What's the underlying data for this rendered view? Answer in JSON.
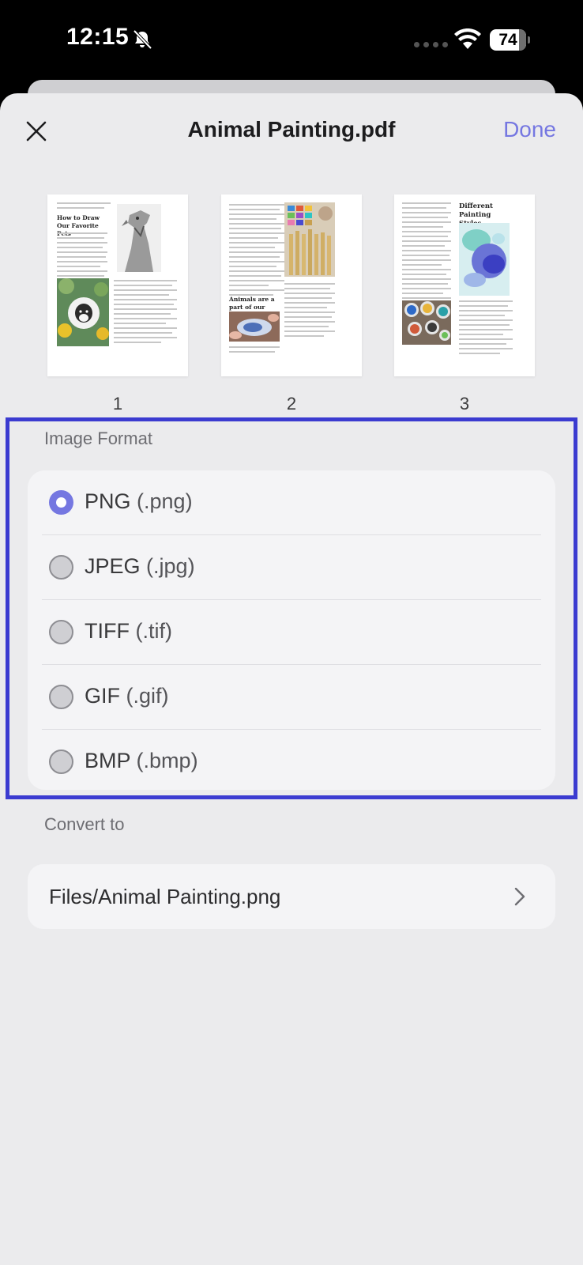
{
  "status_bar": {
    "time": "12:15",
    "battery": "74",
    "icons": [
      "bell-slash-icon",
      "cellular-icon",
      "wifi-icon",
      "battery-icon"
    ]
  },
  "nav": {
    "close_icon": "close-icon",
    "title": "Animal Painting.pdf",
    "done_label": "Done"
  },
  "pages": [
    {
      "number": "1",
      "heading": "How to Draw Our Favorite Pets"
    },
    {
      "number": "2",
      "heading": "Animals are a part of our daily life"
    },
    {
      "number": "3",
      "heading": "Different Painting Styles"
    }
  ],
  "image_format": {
    "label": "Image Format",
    "selected": "PNG",
    "options": [
      {
        "name": "PNG",
        "ext": "(.png)"
      },
      {
        "name": "JPEG",
        "ext": "(.jpg)"
      },
      {
        "name": "TIFF",
        "ext": "(.tif)"
      },
      {
        "name": "GIF",
        "ext": "(.gif)"
      },
      {
        "name": "BMP",
        "ext": "(.bmp)"
      }
    ]
  },
  "convert_to": {
    "label": "Convert to",
    "path": "Files/Animal Painting.png"
  },
  "colors": {
    "accent": "#7577e1",
    "highlight_border": "#3b3bd0",
    "sheet_bg": "#ebebed",
    "card_bg": "#f4f4f6"
  }
}
